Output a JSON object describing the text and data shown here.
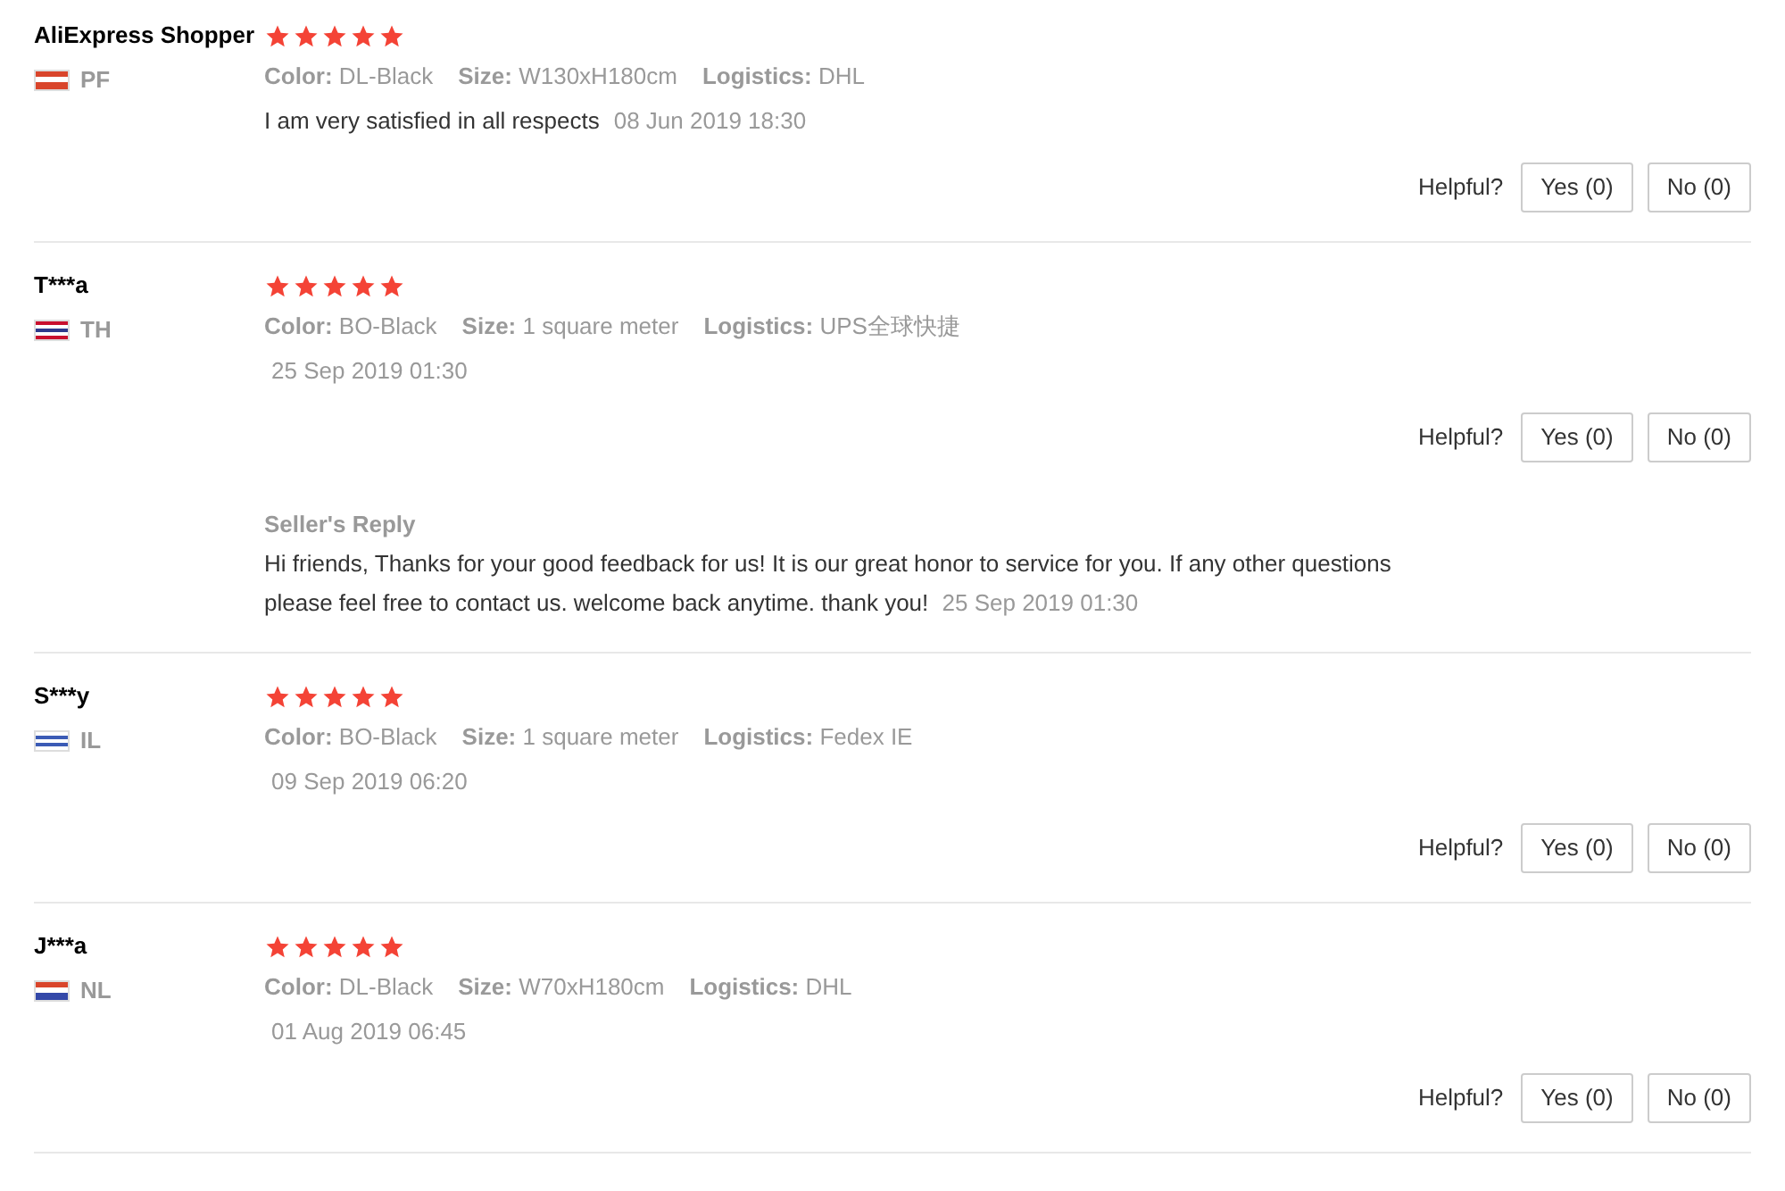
{
  "reviews": [
    {
      "name": "AliExpress Shopper",
      "country": "PF",
      "flag_stripes": [
        {
          "color": "#d9452b"
        },
        {
          "color": "#ffffff"
        },
        {
          "color": "#d9452b"
        }
      ],
      "stars": 5,
      "meta": [
        {
          "label": "Color:",
          "value": "DL-Black"
        },
        {
          "label": "Size:",
          "value": "W130xH180cm"
        },
        {
          "label": "Logistics:",
          "value": "DHL"
        }
      ],
      "comment": "I am very satisfied in all respects",
      "date": "08 Jun 2019 18:30",
      "helpful_label": "Helpful?",
      "yes": "Yes (0)",
      "no": "No (0)"
    },
    {
      "name": "T***a",
      "country": "TH",
      "flag_stripes": [
        {
          "color": "#c8102e"
        },
        {
          "color": "#ffffff"
        },
        {
          "color": "#2d3a8c"
        },
        {
          "color": "#ffffff"
        },
        {
          "color": "#c8102e"
        }
      ],
      "stars": 5,
      "meta": [
        {
          "label": "Color:",
          "value": "BO-Black"
        },
        {
          "label": "Size:",
          "value": "1 square meter"
        },
        {
          "label": "Logistics:",
          "value": "UPS全球快捷"
        }
      ],
      "date": "25 Sep 2019 01:30",
      "helpful_label": "Helpful?",
      "yes": "Yes (0)",
      "no": "No (0)",
      "seller_reply": {
        "title": "Seller's Reply",
        "text": "Hi friends, Thanks for your good feedback for us! It is our great honor to service for you. If any other questions please feel free to contact us. welcome back anytime. thank you!",
        "date": "25 Sep 2019 01:30"
      }
    },
    {
      "name": "S***y",
      "country": "IL",
      "flag_stripes": [
        {
          "color": "#ffffff"
        },
        {
          "color": "#3b5bb5"
        },
        {
          "color": "#ffffff"
        },
        {
          "color": "#3b5bb5"
        },
        {
          "color": "#ffffff"
        }
      ],
      "stars": 5,
      "meta": [
        {
          "label": "Color:",
          "value": "BO-Black"
        },
        {
          "label": "Size:",
          "value": "1 square meter"
        },
        {
          "label": "Logistics:",
          "value": "Fedex IE"
        }
      ],
      "date": "09 Sep 2019 06:20",
      "helpful_label": "Helpful?",
      "yes": "Yes (0)",
      "no": "No (0)"
    },
    {
      "name": "J***a",
      "country": "NL",
      "flag_stripes": [
        {
          "color": "#d9452b"
        },
        {
          "color": "#ffffff"
        },
        {
          "color": "#3348a8"
        }
      ],
      "stars": 5,
      "meta": [
        {
          "label": "Color:",
          "value": "DL-Black"
        },
        {
          "label": "Size:",
          "value": "W70xH180cm"
        },
        {
          "label": "Logistics:",
          "value": "DHL"
        }
      ],
      "date": "01 Aug 2019 06:45",
      "helpful_label": "Helpful?",
      "yes": "Yes (0)",
      "no": "No (0)"
    }
  ]
}
